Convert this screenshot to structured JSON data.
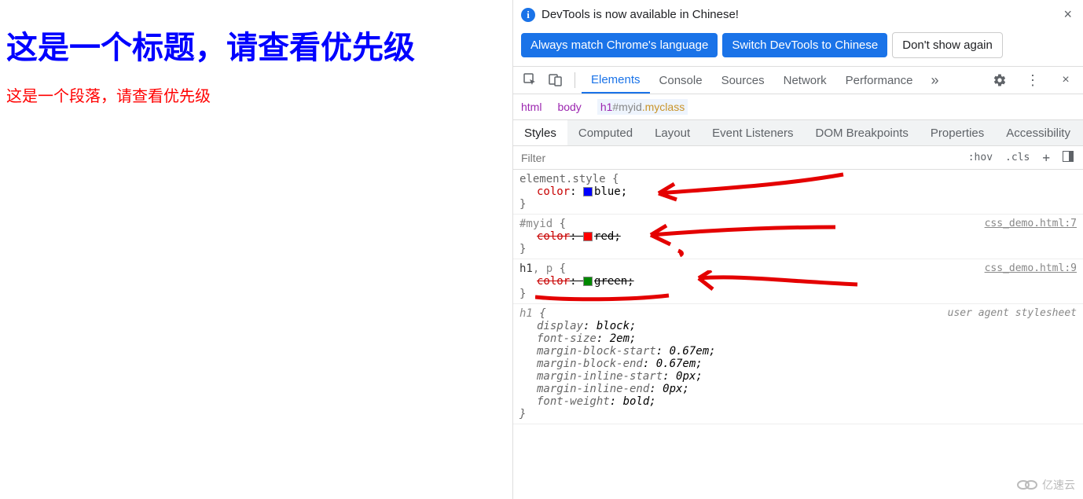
{
  "page": {
    "h1": "这是一个标题，请查看优先级",
    "p": "这是一个段落，请查看优先级"
  },
  "banner": {
    "text": "DevTools is now available in Chinese!",
    "btn_match": "Always match Chrome's language",
    "btn_switch": "Switch DevTools to Chinese",
    "btn_dont": "Don't show again"
  },
  "tabs": {
    "elements": "Elements",
    "console": "Console",
    "sources": "Sources",
    "network": "Network",
    "performance": "Performance"
  },
  "breadcrumb": {
    "html": "html",
    "body": "body",
    "tag": "h1",
    "id": "#myid",
    "cls": ".myclass"
  },
  "subtabs": {
    "styles": "Styles",
    "computed": "Computed",
    "layout": "Layout",
    "listeners": "Event Listeners",
    "dombp": "DOM Breakpoints",
    "props": "Properties",
    "a11y": "Accessibility"
  },
  "filter": {
    "placeholder": "Filter",
    "hov": ":hov",
    "cls": ".cls"
  },
  "rules": {
    "r1": {
      "selector": "element.style",
      "prop": "color",
      "val": "blue",
      "swatch": "#0000ff"
    },
    "r2": {
      "selector": "#myid",
      "prop": "color",
      "val": "red",
      "swatch": "#ff0000",
      "source": "css_demo.html:7"
    },
    "r3": {
      "selector": "h1, p",
      "prop": "color",
      "val": "green",
      "swatch": "#008800",
      "source": "css_demo.html:9"
    },
    "r4": {
      "selector": "h1",
      "source": "user agent stylesheet",
      "decls": [
        {
          "prop": "display",
          "val": "block"
        },
        {
          "prop": "font-size",
          "val": "2em"
        },
        {
          "prop": "margin-block-start",
          "val": "0.67em"
        },
        {
          "prop": "margin-block-end",
          "val": "0.67em"
        },
        {
          "prop": "margin-inline-start",
          "val": "0px"
        },
        {
          "prop": "margin-inline-end",
          "val": "0px"
        },
        {
          "prop": "font-weight",
          "val": "bold"
        }
      ]
    }
  },
  "watermark": "亿速云"
}
